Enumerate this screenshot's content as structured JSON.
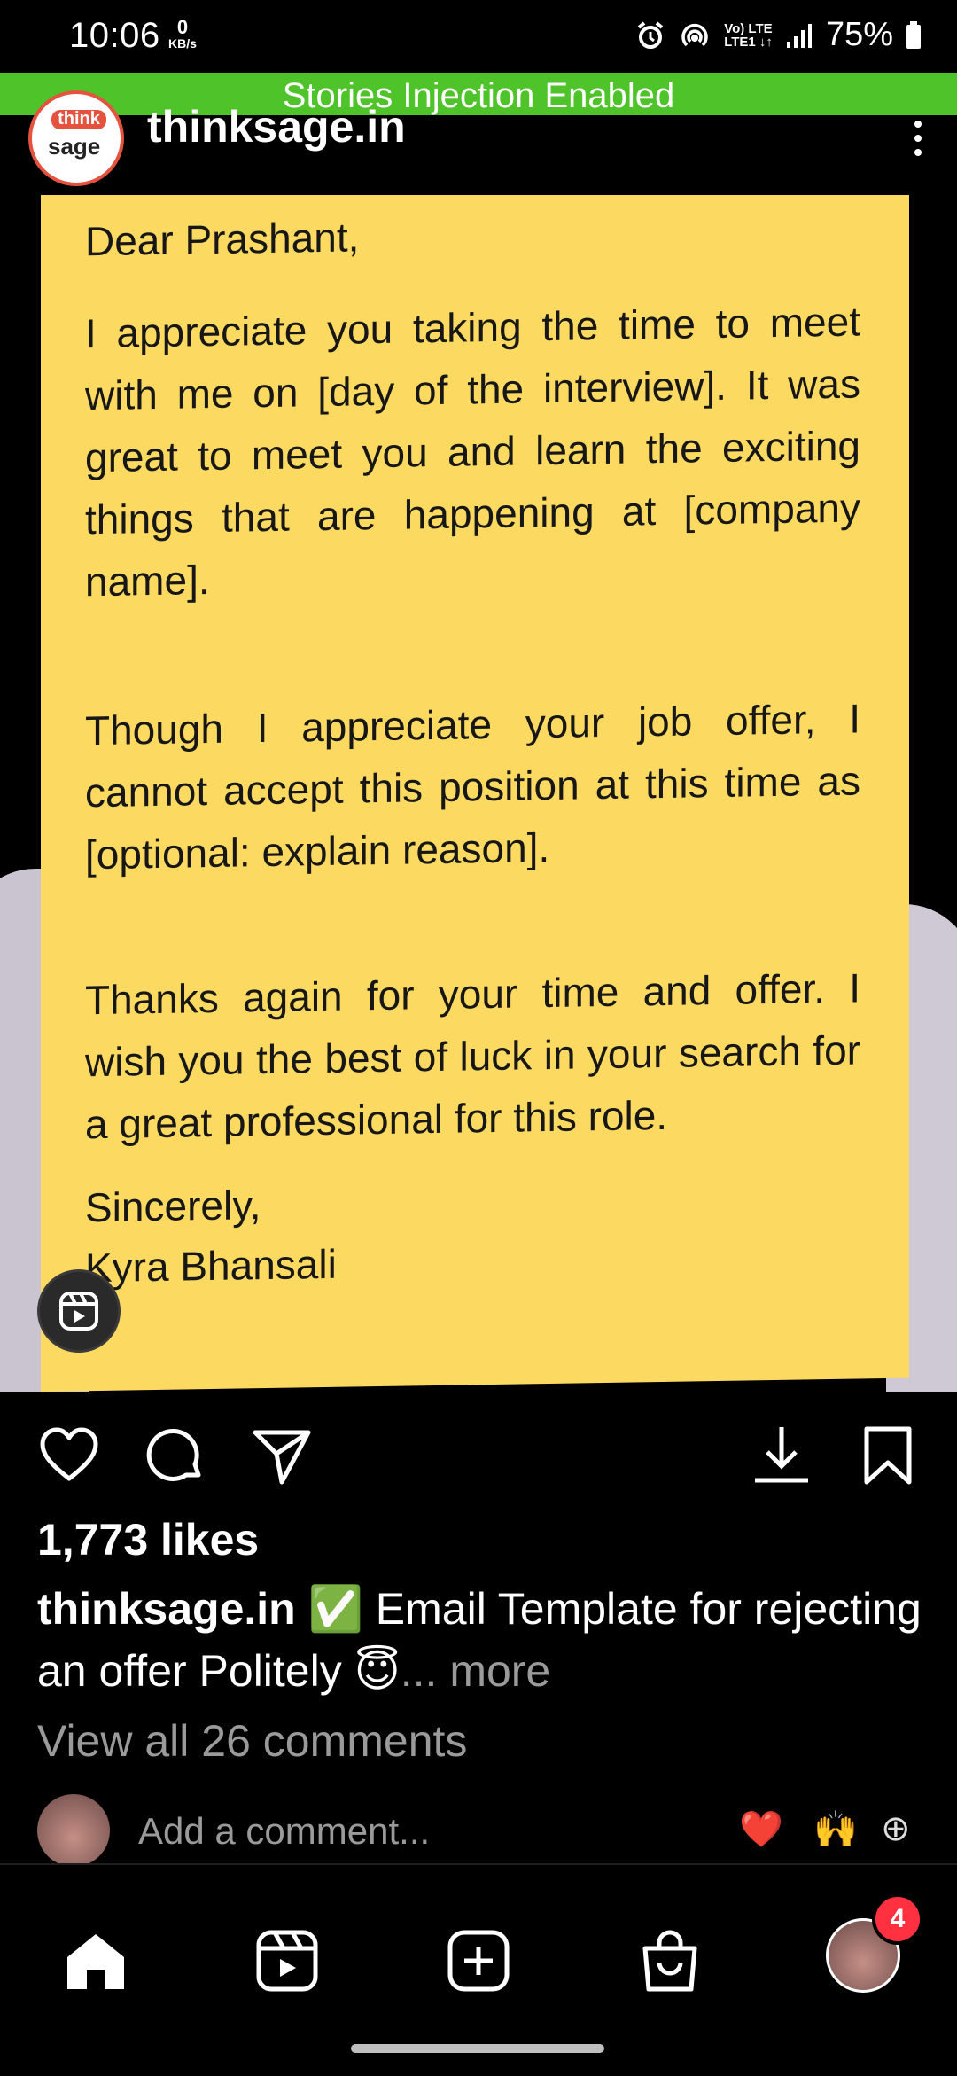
{
  "status_bar": {
    "time": "10:06",
    "speed_value": "0",
    "speed_unit": "KB/s",
    "net_label": "Vo) LTE\nLTE1 ↓↑",
    "battery": "75%"
  },
  "banner": {
    "text": "Stories Injection Enabled",
    "color": "#4fc32a"
  },
  "post_header": {
    "avatar_line1": "think",
    "avatar_line2": "sage",
    "username": "thinksage.in",
    "more_icon": "more-vertical-icon"
  },
  "letter": {
    "greeting": "Dear Prashant,",
    "para1": "I appreciate you taking the time to meet with me on [day of the interview]. It was great to meet you and learn the exciting things that are happening at [company name].",
    "para2": "Though I appreciate your job offer, I cannot accept this position at this time as [optional: explain reason].",
    "para3": "Thanks again for your time and offer. I wish you the best of luck in your search for a great professional for this role.",
    "closing": "Sincerely,",
    "signature": "Kyra Bhansali",
    "background": "#fcd960"
  },
  "actions": {
    "like_icon": "heart-icon",
    "comment_icon": "comment-icon",
    "share_icon": "send-icon",
    "download_icon": "download-icon",
    "save_icon": "bookmark-icon"
  },
  "post": {
    "likes": "1,773 likes",
    "caption_user": "thinksage.in",
    "caption_text": " ✅ Email Template for rejecting an offer Politely 😇",
    "caption_more": "... more",
    "view_comments": "View all 26 comments"
  },
  "comment_bar": {
    "placeholder": "Add a comment...",
    "quick_reactions": [
      "❤️",
      "🙌",
      "⊕"
    ]
  },
  "bottom_nav": {
    "items": [
      "home-icon",
      "reels-icon",
      "create-icon",
      "shop-icon",
      "profile-avatar"
    ],
    "badge": "4"
  }
}
